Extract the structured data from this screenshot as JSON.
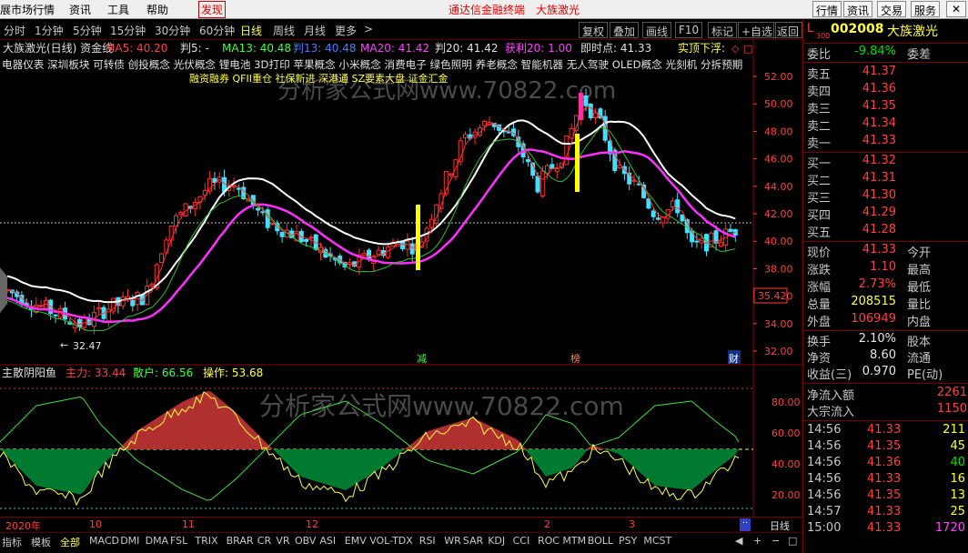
{
  "menu": {
    "items": [
      "展市场行情",
      "资讯",
      "工具",
      "帮助"
    ],
    "discover": "发现",
    "banner": "通达信金融终端",
    "stock_title": "大族激光",
    "right_buttons": [
      "行情",
      "资讯",
      "交易",
      "服务"
    ]
  },
  "periods": [
    "分时",
    "1分钟",
    "5分钟",
    "15分钟",
    "30分钟",
    "60分钟",
    "日线",
    "周线",
    "月线",
    "更多"
  ],
  "period_active": "日线",
  "period_more_arrow": ">",
  "toolbar": [
    "复权",
    "叠加",
    "画线",
    "F10",
    "标记",
    "+自选",
    "返回"
  ],
  "main_header": {
    "title": "大族激光(日线) 资金线",
    "ma5": "MA5: 40.20",
    "pan5": "判5: -",
    "ma13": "MA13: 40.48",
    "pan13": "判13: 40.48",
    "ma20": "MA20: 41.42",
    "pan20": "判20: 41.42",
    "huoli": "获利20: 1.00",
    "jishidian": "即时点: 41.33",
    "shiding": "实顶下浮:"
  },
  "concepts_line1": "电器仪表 深圳板块 可转债 创投概念 光伏概念 锂电池 3D打印 苹果概念 小米概念 消费电子 绿色照明 养老概念 智能机器 无人驾驶 OLED概念 光刻机 分拆预期",
  "concepts_line2": "融资融券 QFII重仓 社保新进 深港通 SZ要素大盘 证金汇金",
  "watermark": "分析家公式网www.70822.com",
  "price_axis": [
    "52.00",
    "50.00",
    "48.00",
    "46.00",
    "44.00",
    "42.00",
    "40.00",
    "38.00",
    "36.00",
    "34.00",
    "32.00"
  ],
  "price_tag": "35.42",
  "low_mark": "32.47",
  "event_marks": {
    "jian": "减",
    "bang": "榜",
    "cai": "财"
  },
  "indicator_header": {
    "name": "主散阴阳鱼",
    "zhuli": "主力: 33.44",
    "sanhu": "散户: 66.56",
    "caozuo": "操作: 53.68"
  },
  "ind_axis": [
    "80.00",
    "60.00",
    "40.00",
    "20.00"
  ],
  "dates": [
    "2020年",
    "10",
    "11",
    "12",
    "2",
    "3"
  ],
  "period_label": "日线",
  "bottom_tabs": [
    "指标",
    "模板",
    "全部",
    "MACD",
    "DMI",
    "DMA",
    "FSL",
    "TRIX",
    "BRAR",
    "CR",
    "VR",
    "OBV",
    "ASI",
    "EMV",
    "VOL-TDX",
    "RSI",
    "WR",
    "SAR",
    "KDJ",
    "CCI",
    "ROC",
    "MTM",
    "BOLL",
    "PSY",
    "MCST"
  ],
  "bottom_tab_active": "全部",
  "bottom_controls": [
    "◀",
    "+",
    "−",
    "□"
  ],
  "quote": {
    "l_mark": "L",
    "l_mark_sub": "300",
    "code": "002008",
    "name": "大族激光",
    "weibi_label": "委比",
    "weibi": "-9.84%",
    "weicha_label": "委差",
    "asks": [
      {
        "label": "卖五",
        "price": "41.37"
      },
      {
        "label": "卖四",
        "price": "41.36"
      },
      {
        "label": "卖三",
        "price": "41.35"
      },
      {
        "label": "卖二",
        "price": "41.34"
      },
      {
        "label": "卖一",
        "price": "41.33"
      }
    ],
    "bids": [
      {
        "label": "买一",
        "price": "41.32"
      },
      {
        "label": "买二",
        "price": "41.31"
      },
      {
        "label": "买三",
        "price": "41.30"
      },
      {
        "label": "买四",
        "price": "41.29"
      },
      {
        "label": "买五",
        "price": "41.28"
      }
    ],
    "stats": [
      {
        "l": "现价",
        "v": "41.33",
        "c": "red",
        "r": "今开"
      },
      {
        "l": "涨跌",
        "v": "1.10",
        "c": "red",
        "r": "最高"
      },
      {
        "l": "涨幅",
        "v": "2.73%",
        "c": "red",
        "r": "最低"
      },
      {
        "l": "总量",
        "v": "208515",
        "c": "yellow",
        "r": "量比"
      },
      {
        "l": "外盘",
        "v": "106949",
        "c": "red",
        "r": "内盘"
      }
    ],
    "stats2": [
      {
        "l": "换手",
        "v": "2.10%",
        "c": "white",
        "r": "股本"
      },
      {
        "l": "净资",
        "v": "8.60",
        "c": "white",
        "r": "流通"
      },
      {
        "l": "收益(三)",
        "v": "0.970",
        "c": "white",
        "r": "PE(动)"
      }
    ],
    "flow": [
      {
        "l": "净流入额",
        "v": "2261"
      },
      {
        "l": "大宗流入",
        "v": "1150"
      }
    ],
    "ticks": [
      {
        "t": "14:56",
        "p": "41.33",
        "pc": "red",
        "v": "211",
        "vc": "yellow"
      },
      {
        "t": "14:56",
        "p": "41.35",
        "pc": "red",
        "v": "45",
        "vc": "yellow"
      },
      {
        "t": "14:56",
        "p": "41.36",
        "pc": "red",
        "v": "40",
        "vc": "green"
      },
      {
        "t": "14:56",
        "p": "41.33",
        "pc": "red",
        "v": "16",
        "vc": "yellow"
      },
      {
        "t": "14:56",
        "p": "41.35",
        "pc": "red",
        "v": "13",
        "vc": "yellow"
      },
      {
        "t": "14:57",
        "p": "41.33",
        "pc": "red",
        "v": "25",
        "vc": "yellow"
      },
      {
        "t": "15:00",
        "p": "41.33",
        "pc": "red",
        "v": "1720",
        "vc": "magenta"
      }
    ]
  }
}
